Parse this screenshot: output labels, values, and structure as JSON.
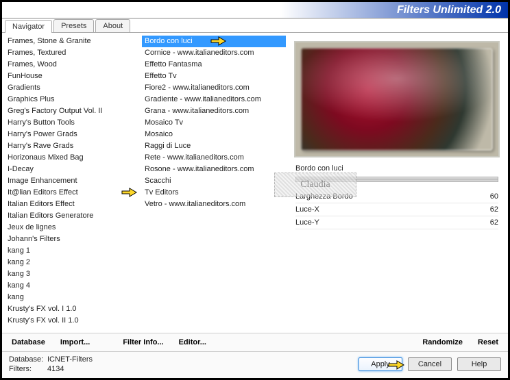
{
  "title": "Filters Unlimited 2.0",
  "tabs": [
    {
      "label": "Navigator",
      "active": true
    },
    {
      "label": "Presets",
      "active": false
    },
    {
      "label": "About",
      "active": false
    }
  ],
  "categories": [
    "Frames, Stone & Granite",
    "Frames, Textured",
    "Frames, Wood",
    "FunHouse",
    "Gradients",
    "Graphics Plus",
    "Greg's Factory Output Vol. II",
    "Harry's Button Tools",
    "Harry's Power Grads",
    "Harry's Rave Grads",
    "Horizonaus Mixed Bag",
    "I-Decay",
    "Image Enhancement",
    "It@lian Editors Effect",
    "Italian Editors Effect",
    "Italian Editors Generatore",
    "Jeux de lignes",
    "Johann's Filters",
    "kang 1",
    "kang 2",
    "kang 3",
    "kang 4",
    "kang",
    "Krusty's FX vol. I 1.0",
    "Krusty's FX vol. II 1.0"
  ],
  "category_pointer_index": 13,
  "filters": [
    "Bordo con luci",
    "Cornice - www.italianeditors.com",
    "Effetto Fantasma",
    "Effetto Tv",
    "Fiore2 - www.italianeditors.com",
    "Gradiente - www.italianeditors.com",
    "Grana - www.italianeditors.com",
    "Mosaico Tv",
    "Mosaico",
    "Raggi di Luce",
    "Rete - www.italianeditors.com",
    "Rosone - www.italianeditors.com",
    "Scacchi",
    "Tv Editors",
    "Vetro - www.italianeditors.com"
  ],
  "filter_selected_index": 0,
  "current_filter_name": "Bordo con luci",
  "params": [
    {
      "label": "Larghezza Bordo",
      "value": "60"
    },
    {
      "label": "Luce-X",
      "value": "62"
    },
    {
      "label": "Luce-Y",
      "value": "62"
    }
  ],
  "buttons_upper": {
    "database": "Database",
    "import": "Import...",
    "filter_info": "Filter Info...",
    "editor": "Editor...",
    "randomize": "Randomize",
    "reset": "Reset"
  },
  "status": {
    "db_label": "Database:",
    "db_value": "ICNET-Filters",
    "filters_label": "Filters:",
    "filters_value": "4134"
  },
  "buttons_lower": {
    "apply": "Apply",
    "cancel": "Cancel",
    "help": "Help"
  },
  "watermark_text": "Claudia"
}
